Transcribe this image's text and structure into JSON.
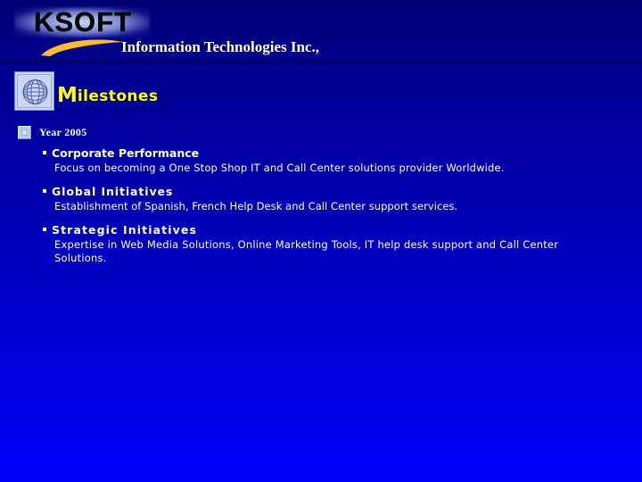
{
  "brand": {
    "logo_text": "KSOFT",
    "logo_swoosh_color": "#f0a81e",
    "company_line": "Information Technologies Inc.,"
  },
  "heading": {
    "title_cap": "M",
    "title_rest": "ilestones",
    "title_color": "#ffff00",
    "icon": "globe-icon"
  },
  "year": {
    "label": "Year 2005",
    "bullet": "square-bullet-icon"
  },
  "blocks": [
    {
      "heading": "Corporate Performance",
      "body": "Focus on  becoming a One Stop Shop IT and Call Center solutions provider Worldwide."
    },
    {
      "heading": "Global Initiatives",
      "body": "Establishment of Spanish, French Help Desk and Call Center support services."
    },
    {
      "heading": "Strategic Initiatives",
      "body": "Expertise in Web Media Solutions, Online Marketing Tools, IT help desk support and Call Center",
      "body_last_line": "Solutions."
    }
  ],
  "theme": {
    "background_top": "#000073",
    "background_bottom": "#0000fd",
    "text_color": "#ffffff",
    "rule_color": "#000033"
  }
}
